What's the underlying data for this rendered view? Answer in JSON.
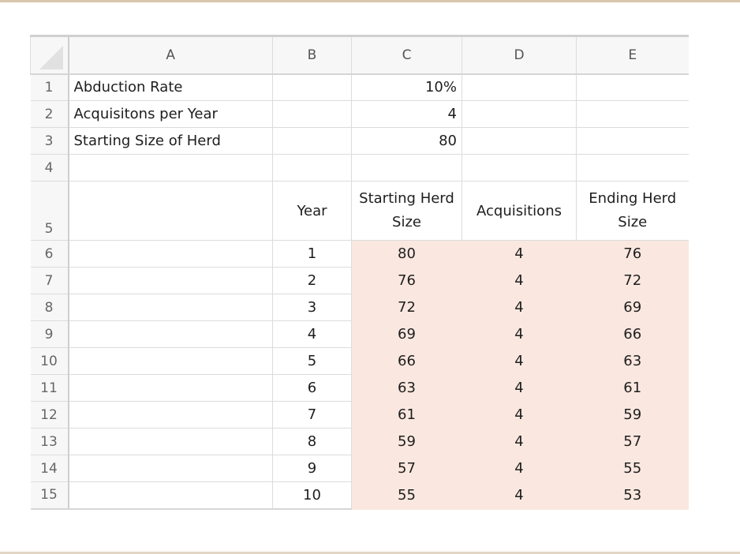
{
  "columns": [
    "A",
    "B",
    "C",
    "D",
    "E"
  ],
  "colors": {
    "highlight": "#fae8e0",
    "frame": "#d9c7ad"
  },
  "rows": [
    {
      "num": "1",
      "A": "Abduction Rate",
      "B": "",
      "C": "10%",
      "D": "",
      "E": ""
    },
    {
      "num": "2",
      "A": "Acquisitons per Year",
      "B": "",
      "C": "4",
      "D": "",
      "E": ""
    },
    {
      "num": "3",
      "A": "Starting Size of Herd",
      "B": "",
      "C": "80",
      "D": "",
      "E": ""
    },
    {
      "num": "4",
      "A": "",
      "B": "",
      "C": "",
      "D": "",
      "E": ""
    },
    {
      "num": "5",
      "A": "",
      "B": "Year",
      "C": "Starting Herd Size",
      "D": "Acquisitions",
      "E": "Ending Herd Size"
    }
  ],
  "table_rows": [
    {
      "num": "6",
      "year": "1",
      "start": "80",
      "acq": "4",
      "end": "76"
    },
    {
      "num": "7",
      "year": "2",
      "start": "76",
      "acq": "4",
      "end": "72"
    },
    {
      "num": "8",
      "year": "3",
      "start": "72",
      "acq": "4",
      "end": "69"
    },
    {
      "num": "9",
      "year": "4",
      "start": "69",
      "acq": "4",
      "end": "66"
    },
    {
      "num": "10",
      "year": "5",
      "start": "66",
      "acq": "4",
      "end": "63"
    },
    {
      "num": "11",
      "year": "6",
      "start": "63",
      "acq": "4",
      "end": "61"
    },
    {
      "num": "12",
      "year": "7",
      "start": "61",
      "acq": "4",
      "end": "59"
    },
    {
      "num": "13",
      "year": "8",
      "start": "59",
      "acq": "4",
      "end": "57"
    },
    {
      "num": "14",
      "year": "9",
      "start": "57",
      "acq": "4",
      "end": "55"
    },
    {
      "num": "15",
      "year": "10",
      "start": "55",
      "acq": "4",
      "end": "53"
    }
  ]
}
